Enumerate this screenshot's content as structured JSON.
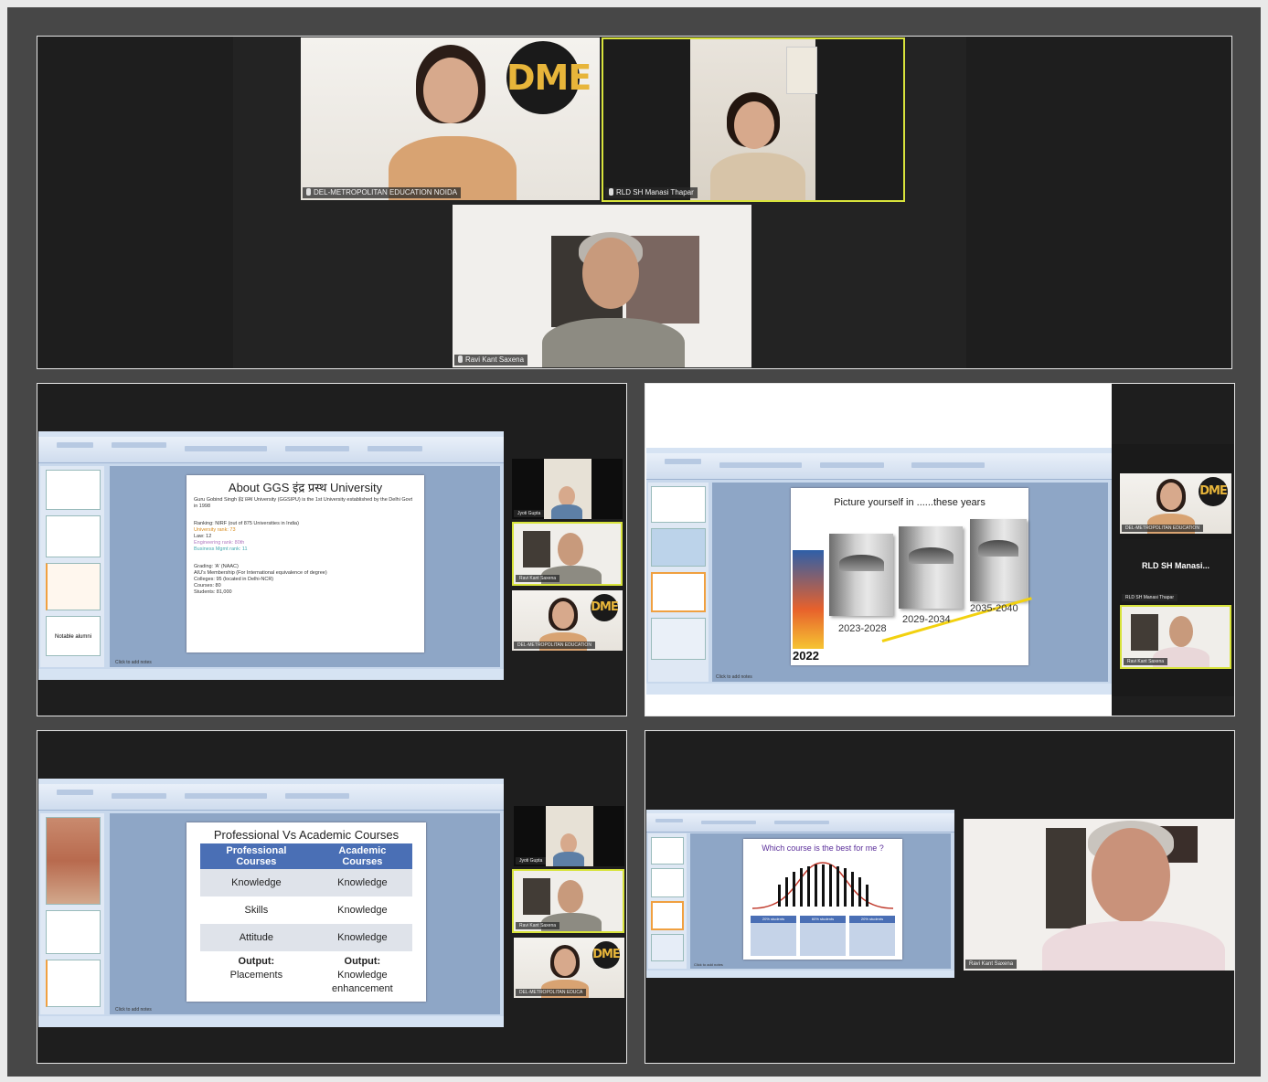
{
  "meeting": {
    "top": {
      "tiles": [
        {
          "name": "DEL-METROPOLITAN EDUCATION NOIDA",
          "logo": "DME"
        },
        {
          "name": "RLD SH Manasi Thapar"
        },
        {
          "name": "Ravi Kant Saxena"
        }
      ]
    },
    "panel_about": {
      "slide_title": "About GGS इंद्र प्रस्थ University",
      "lines": [
        "Guru Gobind Singh इंद्र प्रस्थ University (GGSIPU) is the 1st University established by the Delhi Govt in 1998",
        "Ranking: NIRF (out of 875 Universities in India)",
        "University rank: 73",
        "Law: 12",
        "Engineering rank: 80th",
        "Business Mgmt rank: 11",
        "Grading: 'A' (NAAC)",
        "AIU's Membership (For International equivalence of degree)",
        "Colleges: 95 (located in Delhi-NCR)",
        "Courses: 80",
        "Students: 81,000"
      ],
      "notes": "Click to add notes",
      "thumb_label": "Notable alumni",
      "side": [
        {
          "name": "Jyoti Gupta"
        },
        {
          "name": "Ravi Kant Saxena"
        },
        {
          "name": "DEL-METROPOLITAN EDUCATION",
          "logo": "DME"
        }
      ]
    },
    "panel_picture": {
      "slide_title": "Picture yourself in ......these years",
      "years": [
        "2022",
        "2023-2028",
        "2029-2034",
        "2035-2040"
      ],
      "notes": "Click to add notes",
      "side": [
        {
          "name": "DEL-METROPOLITAN EDUCATION",
          "logo": "DME"
        },
        {
          "name": "RLD SH Manasi Thapar",
          "big_label": "RLD SH Manasi..."
        },
        {
          "name": "Ravi Kant Saxena"
        }
      ]
    },
    "panel_courses": {
      "slide_title": "Professional Vs Academic Courses",
      "headers": [
        "Professional Courses",
        "Academic Courses"
      ],
      "rows": [
        [
          "Knowledge",
          "Knowledge"
        ],
        [
          "Skills",
          "Knowledge"
        ],
        [
          "Attitude",
          "Knowledge"
        ]
      ],
      "output_label": "Output:",
      "output_left": "Placements",
      "output_right_1": "Knowledge",
      "output_right_2": "enhancement",
      "notes": "Click to add notes",
      "side": [
        {
          "name": "Jyoti Gupta"
        },
        {
          "name": "Ravi Kant Saxena"
        },
        {
          "name": "DEL-METROPOLITAN EDUCA",
          "logo": "DME"
        }
      ]
    },
    "panel_which": {
      "slide_title": "Which course is the best for me ?",
      "boxes": [
        "20% students",
        "60% students",
        "20% students"
      ],
      "notes": "Click to add notes",
      "speaker": {
        "name": "Ravi Kant Saxena"
      }
    }
  }
}
